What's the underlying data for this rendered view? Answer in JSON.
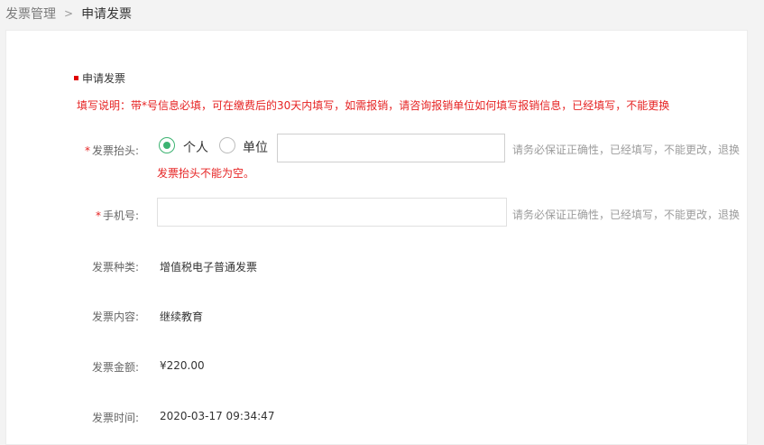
{
  "breadcrumb": {
    "parent": "发票管理",
    "separator": ">",
    "current": "申请发票"
  },
  "section": {
    "title": "申请发票",
    "notice": "填写说明：带*号信息必填，可在缴费后的30天内填写，如需报销，请咨询报销单位如何填写报销信息，已经填写，不能更换"
  },
  "form": {
    "required_mark": "*",
    "title_field": {
      "label": "发票抬头:",
      "options": [
        {
          "label": "个人",
          "selected": true
        },
        {
          "label": "单位",
          "selected": false
        }
      ],
      "value": "",
      "placeholder": "",
      "hint": "请务必保证正确性，已经填写，不能更改，退换",
      "error": "发票抬头不能为空。"
    },
    "phone_field": {
      "label": "手机号:",
      "value": "",
      "placeholder": "",
      "hint": "请务必保证正确性，已经填写，不能更改，退换"
    },
    "invoice_type": {
      "label": "发票种类:",
      "value": "增值税电子普通发票"
    },
    "invoice_content": {
      "label": "发票内容:",
      "value": "继续教育"
    },
    "invoice_amount": {
      "label": "发票金额:",
      "value": "¥220.00"
    },
    "invoice_time": {
      "label": "发票时间:",
      "value": "2020-03-17 09:34:47"
    }
  },
  "colors": {
    "accent_red": "#e62323",
    "radio_green": "#3cb371",
    "background": "#f3f3f3"
  }
}
